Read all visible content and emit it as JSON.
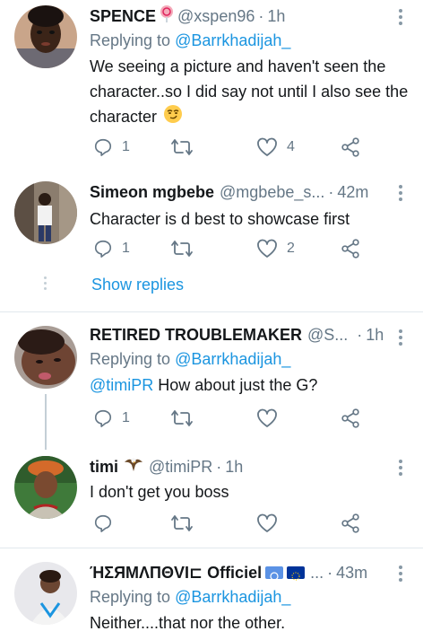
{
  "tweets": [
    {
      "name": "SPENCE",
      "handle": "@xspen96",
      "dot": "·",
      "time": "1h",
      "replying_prefix": "Replying to ",
      "replying_to": "@Barrkhadijah_",
      "text": "We seeing a picture and haven't seen the character..so I did say not until I also see the character",
      "replies": "1",
      "retweets": "",
      "likes": "4",
      "name_emoji": "lollipop-icon",
      "text_emoji": "smirk-emoji"
    },
    {
      "name": "Simeon mgbebe",
      "handle": "@mgbebe_s...",
      "dot": "·",
      "time": "42m",
      "text": "Character is d best to showcase first",
      "replies": "1",
      "retweets": "",
      "likes": "2"
    },
    {
      "name": "RETIRED TROUBLEMAKER",
      "handle": "@S...",
      "dot": "·",
      "time": "1h",
      "replying_prefix": "Replying to ",
      "replying_to": "@Barrkhadijah_",
      "text_mention": "@timiPR",
      "text": " How about just the G?",
      "replies": "1",
      "retweets": "",
      "likes": ""
    },
    {
      "name": "timi",
      "handle": "@timiPR",
      "dot": "·",
      "time": "1h",
      "text": "I don't get you boss",
      "replies": "",
      "retweets": "",
      "likes": "",
      "name_emoji": "eagle-icon"
    },
    {
      "name": "ΉΣЯMΛПΘVI⊏ Officiel",
      "handle": "...",
      "dot": "·",
      "time": "43m",
      "replying_prefix": "Replying to ",
      "replying_to": "@Barrkhadijah_",
      "text": "Neither....that nor the other.",
      "flags": [
        "un-flag-icon",
        "eu-flag-icon"
      ]
    }
  ],
  "show_replies": "Show replies",
  "colors": {
    "link": "#1b95e0",
    "secondary": "#657786",
    "icon": "#657786",
    "divider": "#e1e8ed"
  }
}
